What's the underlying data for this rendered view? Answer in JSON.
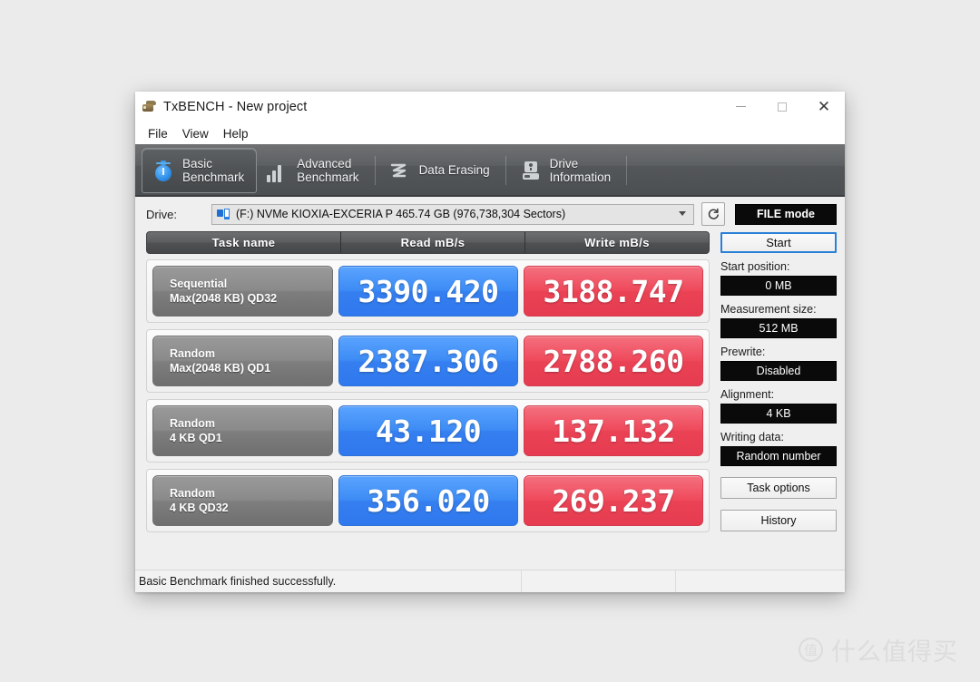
{
  "window": {
    "title": "TxBENCH - New project",
    "app_icon": "drive-stack-icon",
    "controls": {
      "minimize": "minimize-icon",
      "maximize": "maximize-icon",
      "close": "close-icon"
    }
  },
  "menubar": {
    "items": [
      {
        "label": "File"
      },
      {
        "label": "View"
      },
      {
        "label": "Help"
      }
    ]
  },
  "tabs": [
    {
      "label": "Basic\nBenchmark",
      "icon": "stopwatch-icon",
      "active": true
    },
    {
      "label": "Advanced\nBenchmark",
      "icon": "bar-chart-icon",
      "active": false
    },
    {
      "label": "Data Erasing",
      "icon": "shred-icon",
      "active": false
    },
    {
      "label": "Drive\nInformation",
      "icon": "drive-icon",
      "active": false
    }
  ],
  "drive_row": {
    "label": "Drive:",
    "icon": "drive-small-icon",
    "selected": "(F:) NVMe KIOXIA-EXCERIA P  465.74 GB (976,738,304 Sectors)",
    "refresh_icon": "refresh-icon",
    "file_mode_label": "FILE mode"
  },
  "table": {
    "headers": [
      "Task name",
      "Read mB/s",
      "Write mB/s"
    ],
    "rows": [
      {
        "task_line1": "Sequential",
        "task_line2": "Max(2048 KB) QD32",
        "read": "3390.420",
        "write": "3188.747"
      },
      {
        "task_line1": "Random",
        "task_line2": "Max(2048 KB) QD1",
        "read": "2387.306",
        "write": "2788.260"
      },
      {
        "task_line1": "Random",
        "task_line2": "4 KB QD1",
        "read": "43.120",
        "write": "137.132"
      },
      {
        "task_line1": "Random",
        "task_line2": "4 KB QD32",
        "read": "356.020",
        "write": "269.237"
      }
    ]
  },
  "side_panel": {
    "start_button": "Start",
    "start_position_label": "Start position:",
    "start_position_value": "0 MB",
    "measurement_size_label": "Measurement size:",
    "measurement_size_value": "512 MB",
    "prewrite_label": "Prewrite:",
    "prewrite_value": "Disabled",
    "alignment_label": "Alignment:",
    "alignment_value": "4 KB",
    "writing_data_label": "Writing data:",
    "writing_data_value": "Random number",
    "task_options_button": "Task options",
    "history_button": "History"
  },
  "statusbar": {
    "message": "Basic Benchmark finished successfully.",
    "pane2": "",
    "pane3": ""
  },
  "watermark": {
    "mark": "值",
    "text": "什么值得买"
  },
  "colors": {
    "read_accent": "#3d8cf5",
    "write_accent": "#ef4a5c",
    "tab_bar": "#5d6062",
    "start_border": "#2a7fd6",
    "value_chip_bg": "#0a0a0a",
    "page_background": "#ebebeb"
  }
}
